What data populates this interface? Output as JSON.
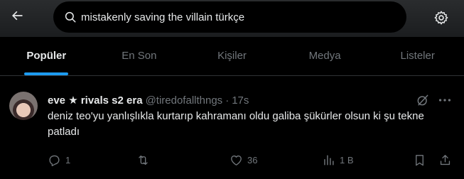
{
  "search": {
    "query": "mistakenly saving the villain türkçe"
  },
  "tabs": [
    {
      "label": "Popüler",
      "active": true
    },
    {
      "label": "En Son",
      "active": false
    },
    {
      "label": "Kişiler",
      "active": false
    },
    {
      "label": "Medya",
      "active": false
    },
    {
      "label": "Listeler",
      "active": false
    }
  ],
  "tweet": {
    "display_name": "eve ★ rivals s2 era",
    "handle": "@tiredofallthngs",
    "separator": "·",
    "time": "17s",
    "text": "deniz teo'yu yanlışlıkla kurtarıp kahramanı oldu galiba şükürler olsun ki şu tekne patladı",
    "replies": "1",
    "retweets": "",
    "likes": "36",
    "views": "1 B"
  },
  "colors": {
    "accent": "#1d9bf0",
    "text_primary": "#e7e9ea",
    "text_secondary": "#71767b",
    "background": "#000000"
  },
  "icons": {
    "back": "arrow-left-icon",
    "search": "search-icon",
    "settings": "gear-icon",
    "grok": "grok-icon",
    "more": "more-horizontal-icon",
    "reply": "reply-icon",
    "retweet": "retweet-icon",
    "like": "heart-icon",
    "views": "views-icon",
    "bookmark": "bookmark-icon",
    "share": "share-icon"
  }
}
